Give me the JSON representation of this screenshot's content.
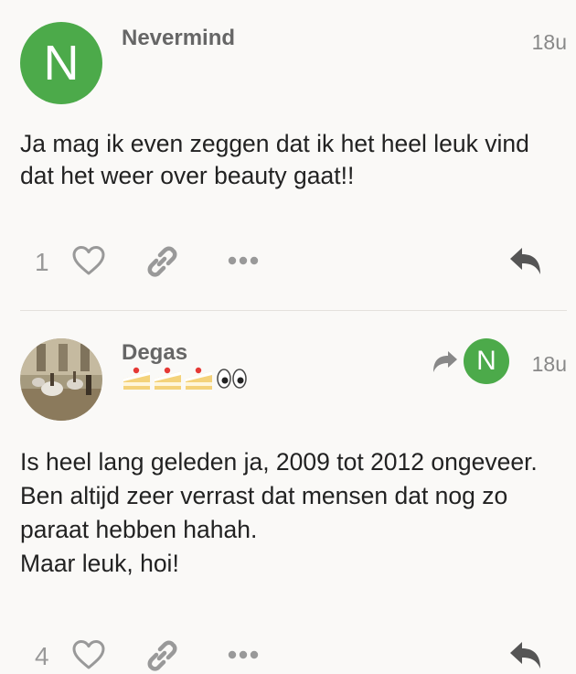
{
  "posts": [
    {
      "username": "Nevermind",
      "avatar_letter": "N",
      "time": "18u",
      "body": [
        "Ja mag ik even zeggen dat ik het heel leuk vind dat het weer over beauty gaat!!"
      ],
      "likes": "1"
    },
    {
      "username": "Degas",
      "time": "18u",
      "reply_to_letter": "N",
      "body": [
        "Is heel lang geleden ja, 2009 tot 2012 ongeveer. Ben altijd zeer verrast dat mensen dat nog zo paraat hebben hahah.",
        "Maar leuk, hoi!"
      ],
      "likes": "4"
    }
  ],
  "colors": {
    "avatar_green": "#4caa4a",
    "background": "#faf9f7",
    "icon_gray": "#999999"
  },
  "icons": [
    "heart-icon",
    "link-icon",
    "more-icon",
    "reply-icon",
    "reply-arrow-icon"
  ]
}
